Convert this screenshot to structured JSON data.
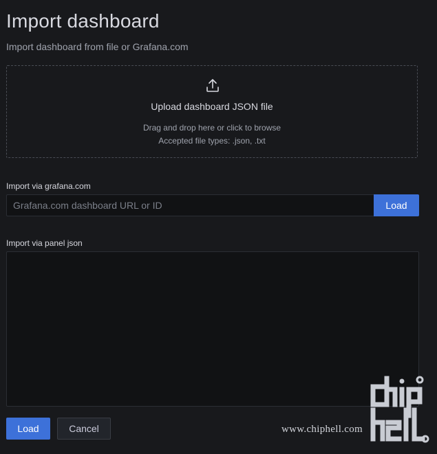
{
  "header": {
    "title": "Import dashboard",
    "subtitle": "Import dashboard from file or Grafana.com"
  },
  "upload": {
    "icon": "upload-icon",
    "title": "Upload dashboard JSON file",
    "hint": "Drag and drop here or click to browse",
    "accepted": "Accepted file types: .json, .txt"
  },
  "grafana_import": {
    "label": "Import via grafana.com",
    "placeholder": "Grafana.com dashboard URL or ID",
    "value": "",
    "button_label": "Load"
  },
  "panel_json": {
    "label": "Import via panel json",
    "value": ""
  },
  "footer": {
    "load_label": "Load",
    "cancel_label": "Cancel"
  },
  "watermark": {
    "site": "www.chiphell.com",
    "logo": "chiphell-logo"
  },
  "colors": {
    "background": "#18191c",
    "primary": "#3d71d9",
    "input_bg": "#111214"
  }
}
